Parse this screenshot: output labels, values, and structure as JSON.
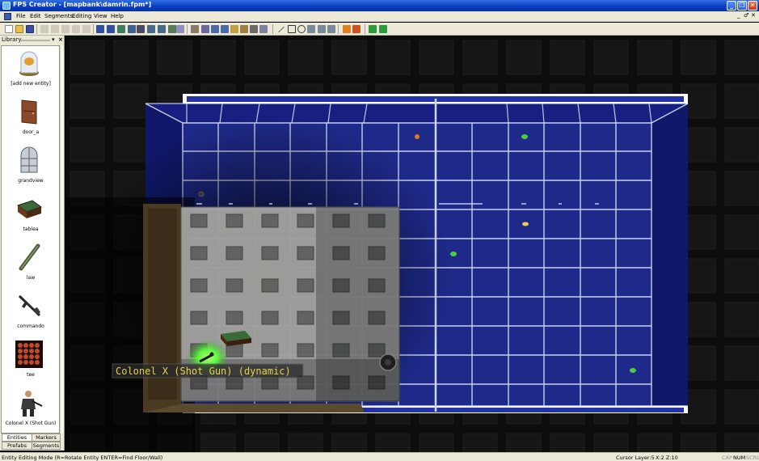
{
  "window": {
    "title": "FPS Creator - [mapbank\\damrin.fpm*]",
    "buttons": [
      "_",
      "❐",
      "✕"
    ],
    "mdi_buttons": [
      "_",
      "♂",
      "✕"
    ]
  },
  "menu": {
    "items": [
      "File",
      "Edit",
      "Segments",
      "Editing",
      "View",
      "Help"
    ]
  },
  "library": {
    "title": "Library",
    "pin": "▾",
    "close": "×",
    "entities": [
      {
        "label": "[add new entity]",
        "icon": "add-entity-icon"
      },
      {
        "label": "door_a",
        "icon": "door-icon"
      },
      {
        "label": "grandview",
        "icon": "window-icon"
      },
      {
        "label": "tablea",
        "icon": "table-icon"
      },
      {
        "label": "law",
        "icon": "rocket-launcher-icon"
      },
      {
        "label": "commando",
        "icon": "rifle-icon"
      },
      {
        "label": "tee",
        "icon": "tee-icon"
      },
      {
        "label": "Colonel X (Shot Gun)",
        "icon": "character-icon"
      }
    ],
    "tabs": {
      "entities": "Entities",
      "markers": "Markers",
      "prefabs": "Prefabs",
      "segments": "Segments"
    }
  },
  "viewport": {
    "entity_label": "Colonel X (Shot Gun) (dynamic)"
  },
  "status": {
    "mode": "Entity Editing Mode (R=Rotate Entity  ENTER=Find Floor/Wall)",
    "cursor_layer": "Cursor Layer:5",
    "coords": "X:2  Z:10",
    "caps": "CAP",
    "num": "NUM",
    "scrl": "SCRL"
  },
  "colors": {
    "titlebar": "#0a3fc0",
    "grid_floor": "#1e2a7a",
    "grid_lines": "#e8ecff",
    "highlight_green": "#5cff3a",
    "label_yellow": "#e8d04a"
  }
}
